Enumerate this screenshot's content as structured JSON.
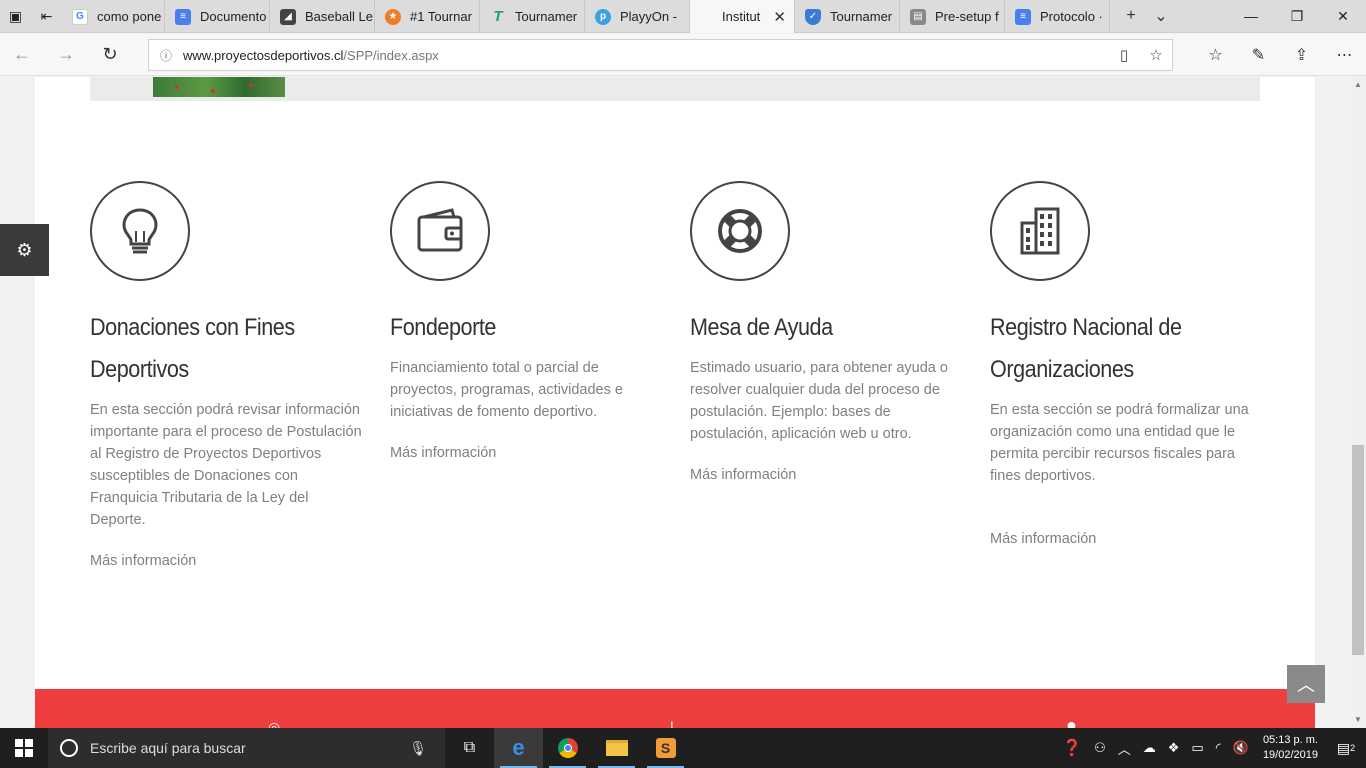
{
  "browser": {
    "tabs": [
      {
        "label": "como pone",
        "favicon": "google-icon",
        "color": "#4285f4"
      },
      {
        "label": "Documento",
        "favicon": "docs-icon",
        "color": "#4a7ff0"
      },
      {
        "label": "Baseball Le",
        "favicon": "baseball-icon",
        "color": "#444444"
      },
      {
        "label": "#1 Tournar",
        "favicon": "star-icon",
        "color": "#f07c24"
      },
      {
        "label": "Tournamer",
        "favicon": "t-logo-icon",
        "color": "#1fa463"
      },
      {
        "label": "PlayyOn - ",
        "favicon": "playyon-icon",
        "color": "#3aa0e0"
      },
      {
        "label": "Institut",
        "favicon": "",
        "color": "",
        "active": true
      },
      {
        "label": "Tournamer",
        "favicon": "shield-icon",
        "color": "#3b7bd4"
      },
      {
        "label": "Pre-setup f",
        "favicon": "sheet-icon",
        "color": "#888888"
      },
      {
        "label": "Protocolo ·",
        "favicon": "docs-icon",
        "color": "#4a7ff0"
      }
    ],
    "url_host": "www.proyectosdeportivos.cl",
    "url_path": "/SPP/index.aspx"
  },
  "sections": [
    {
      "icon": "lightbulb-icon",
      "title": "Donaciones con Fines Deportivos",
      "text": "En esta sección podrá revisar información importante para el proceso de Postulación al Registro de Proyectos Deportivos susceptibles de Donaciones con Franquicia Tributaria de la Ley del Deporte.",
      "link": "Más información"
    },
    {
      "icon": "wallet-icon",
      "title": "Fondeporte",
      "text": "Financiamiento total o parcial de proyectos, programas, actividades e iniciativas de fomento deportivo.",
      "link": "Más información"
    },
    {
      "icon": "lifebuoy-icon",
      "title": "Mesa de Ayuda",
      "text": "Estimado usuario, para obtener ayuda o resolver cualquier duda del proceso de postulación. Ejemplo: bases de postulación, aplicación web u otro.",
      "link": "Más información"
    },
    {
      "icon": "building-icon",
      "title": "Registro Nacional de Organizaciones",
      "text": "En esta sección se podrá formalizar una organización como una entidad que le permita percibir recursos fiscales para fines deportivos.",
      "link": "Más información"
    }
  ],
  "colors": {
    "footer_red": "#ee3e40",
    "icon_stroke": "#444444"
  },
  "taskbar": {
    "search_placeholder": "Escribe aquí para buscar",
    "time": "05:13 p. m.",
    "date": "19/02/2019",
    "notifications": "2"
  }
}
